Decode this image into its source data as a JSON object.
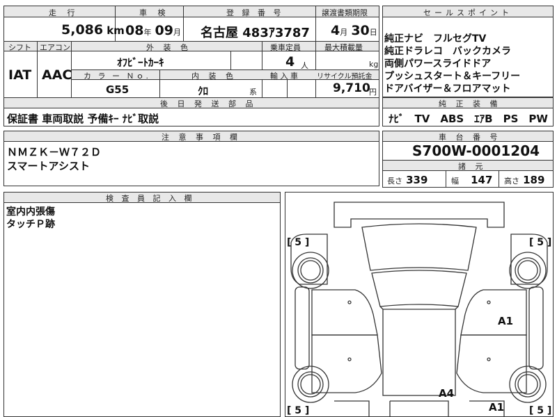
{
  "mileage": {
    "label": "走 行",
    "value": "5,086",
    "unit": "km"
  },
  "inspection": {
    "label": "車 検",
    "year": "08",
    "year_unit": "年",
    "month": "09",
    "month_unit": "月"
  },
  "registration": {
    "label": "登 録 番 号",
    "value": "名古屋 483ｱ3787"
  },
  "transfer": {
    "label": "譲渡書類期限",
    "month": "4",
    "month_unit": "月",
    "day": "30",
    "day_unit": "日"
  },
  "shift": {
    "label": "シフト",
    "value": "IAT"
  },
  "aircon": {
    "label": "エアコン",
    "value": "AAC"
  },
  "exterior_color": {
    "label": "外 装 色",
    "value": "ｵﾌﾋﾞｰﾄｶｰｷ"
  },
  "capacity": {
    "label": "乗車定員",
    "value": "4",
    "unit": "人"
  },
  "max_load": {
    "label": "最大積載量",
    "unit": "kg"
  },
  "color_no": {
    "label": "カ ラ ー Ｎｏ.",
    "value": "G55"
  },
  "interior_color": {
    "label": "内 装 色",
    "value": "ｸﾛ",
    "suffix": "系"
  },
  "import": {
    "label": "輸 入 車"
  },
  "recycle": {
    "label": "リサイクル預託金",
    "value": "9,710",
    "unit": "円"
  },
  "later_parts": {
    "label": "後 日 発 送 部 品",
    "value": "保証書 車両取説 予備ｷｰ ﾅﾋﾞ取説"
  },
  "notes": {
    "label": "注 意 事 項 欄",
    "lines": [
      "ＮＭＺＫ－Ｗ７２Ｄ",
      "スマートアシスト"
    ]
  },
  "sales_points": {
    "label": "セールスポイント",
    "lines": [
      "純正ナビ　フルセグTV",
      "純正ドラレコ　バックカメラ",
      "両側パワースライドドア",
      "プッシュスタート＆キーフリー",
      "ドアバイザー＆フロアマット"
    ]
  },
  "equipment": {
    "label": "純 正 装 備",
    "value": "ﾅﾋﾞ　TV　ABS　ｴｱB　PS　PW"
  },
  "chassis": {
    "label": "車 台 番 号",
    "value": "S700W-0001204"
  },
  "specs": {
    "label": "諸 元",
    "length_label": "長さ",
    "length": "339",
    "width_label": "幅",
    "width": "147",
    "height_label": "高さ",
    "height": "189"
  },
  "inspector": {
    "label": "検 査 員 記 入 欄",
    "lines": [
      "室内内張傷",
      "タッチＰ跡"
    ]
  },
  "diagram": {
    "scores": [
      "[ 5 ]",
      "[ 5 ]",
      "[ 5 ]",
      "[ 5 ]"
    ],
    "marks": [
      "A1",
      "A4",
      "A1"
    ]
  },
  "colors": {
    "header_bg": "#e8e8e8",
    "line": "#333333"
  }
}
